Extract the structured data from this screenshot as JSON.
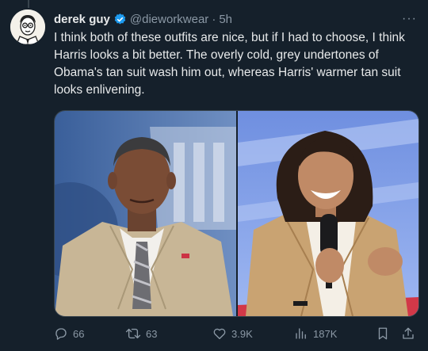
{
  "tweet": {
    "author_name": "derek guy",
    "handle": "@dieworkwear",
    "separator": "·",
    "time": "5h",
    "more_label": "···",
    "text": "I think both of these outfits are nice, but if I had to choose, I think Harris looks a bit better. The overly cold, grey undertones of Obama's tan suit wash him out, whereas Harris' warmer tan suit looks enlivening."
  },
  "media": {
    "left_image": "man-in-tan-suit-photo",
    "right_image": "woman-in-tan-suit-photo"
  },
  "actions": {
    "replies": "66",
    "reposts": "63",
    "likes": "3.9K",
    "views": "187K"
  },
  "colors": {
    "background": "#15202b",
    "text": "#e7e9ea",
    "muted": "#8b98a5",
    "verified": "#1d9bf0"
  }
}
